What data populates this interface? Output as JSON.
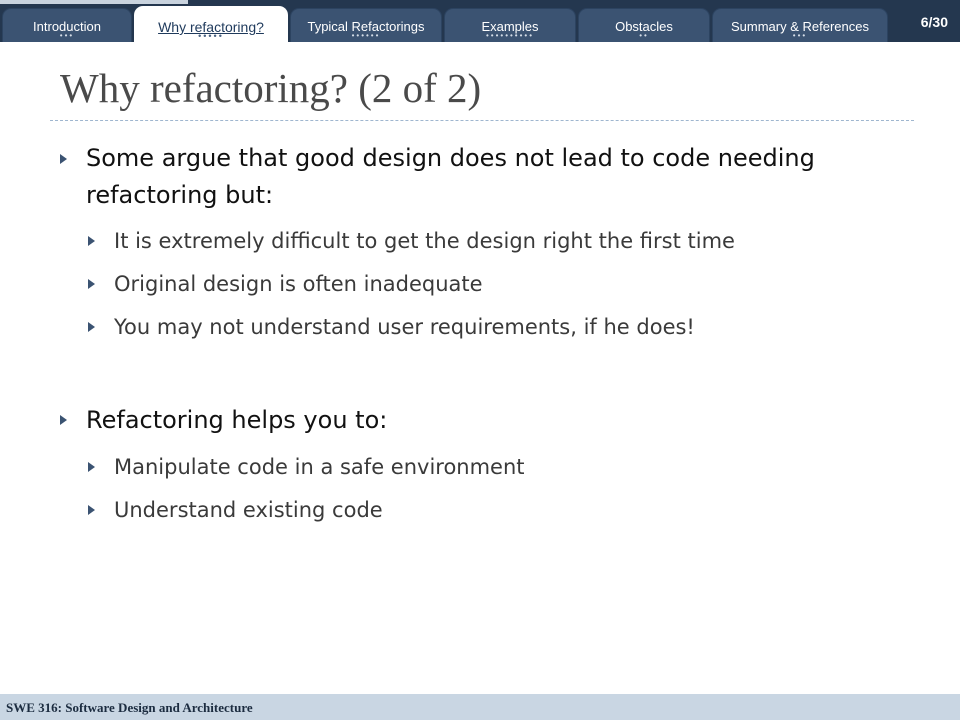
{
  "nav": {
    "tabs": [
      {
        "label": "Introduction",
        "dots": "•••",
        "active": false
      },
      {
        "label": "Why refactoring?",
        "dots": "•••••",
        "active": true
      },
      {
        "label": "Typical Refactorings",
        "dots": "••••••",
        "active": false
      },
      {
        "label": "Examples",
        "dots": "••••••••••",
        "active": false
      },
      {
        "label": "Obstacles",
        "dots": "••",
        "active": false
      },
      {
        "label": "Summary & References",
        "dots": "•••",
        "active": false
      }
    ],
    "page_number": "6/30"
  },
  "slide": {
    "title": "Why refactoring? (2 of 2)",
    "bullets": [
      {
        "text": "Some argue that good design does not lead to code needing refactoring but:",
        "sub": [
          "It is extremely difficult to get the design right the first time",
          "Original design is often inadequate",
          "You may not understand user requirements, if he does!"
        ]
      },
      {
        "text": "Refactoring helps you to:",
        "sub": [
          "Manipulate code in a safe environment",
          "Understand existing code"
        ]
      }
    ]
  },
  "footer": {
    "course": "SWE 316: Software Design and Architecture"
  },
  "colors": {
    "nav_background": "#24374f",
    "tab_background": "#3b5372",
    "footer_background": "#c9d6e3",
    "bullet_arrow": "#3b5372"
  },
  "icons": {
    "bullet": "right-arrow-bullet-icon"
  }
}
